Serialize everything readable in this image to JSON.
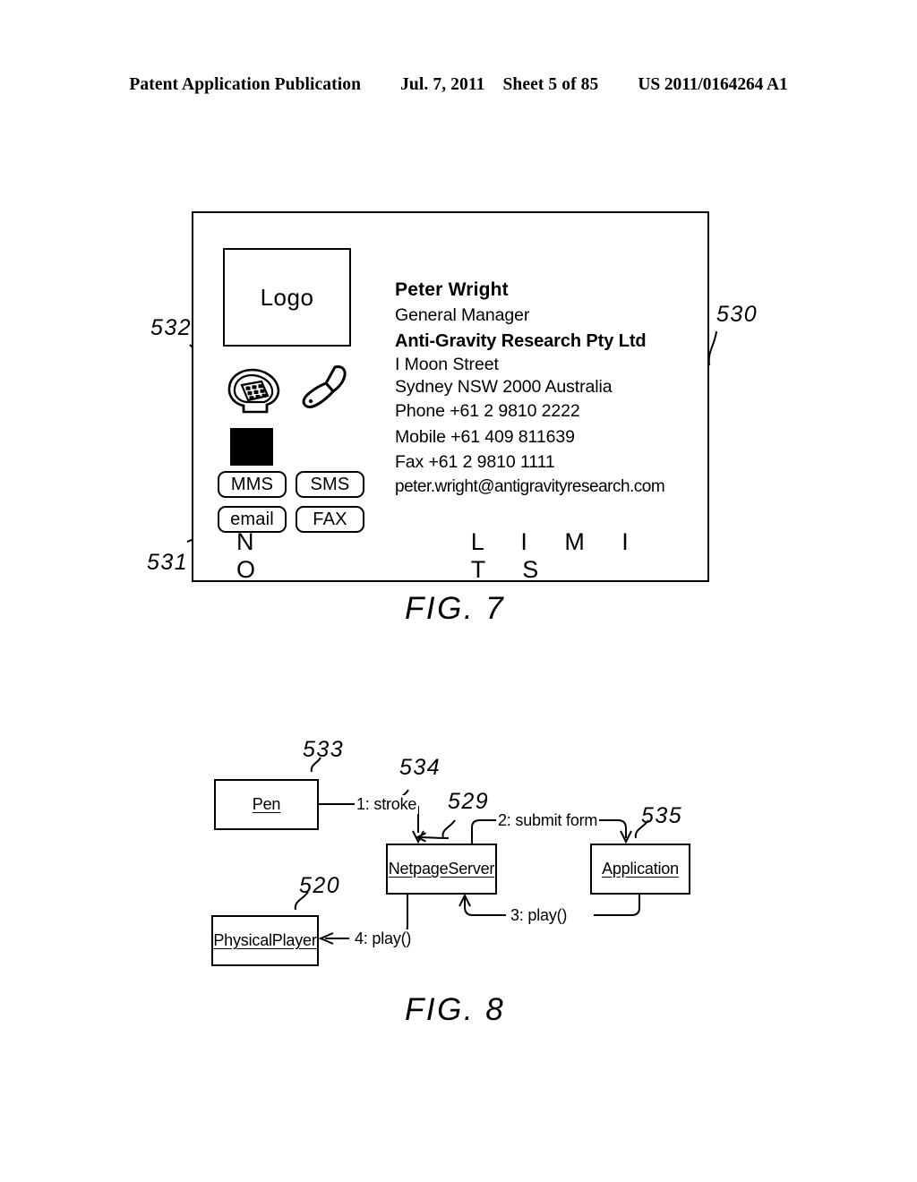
{
  "header": {
    "title": "Patent Application Publication",
    "date": "Jul. 7, 2011",
    "sheet": "Sheet 5 of 85",
    "number": "US 2011/0164264 A1"
  },
  "fig7": {
    "caption": "FIG. 7",
    "logo_label": "Logo",
    "refs": {
      "card": "530",
      "icons": "532",
      "buttons": "531"
    },
    "contact": {
      "name": "Peter Wright",
      "role": "General Manager",
      "company": "Anti-Gravity Research Pty Ltd",
      "street": "I Moon Street",
      "city": "Sydney NSW 2000 Australia",
      "phone": "Phone +61 2 9810 2222",
      "mobile": "Mobile +61 409 811639",
      "fax": "Fax +61 2 9810 1111",
      "email": "peter.wright@antigravityresearch.com"
    },
    "buttons": [
      {
        "label": "MMS"
      },
      {
        "label": "SMS"
      },
      {
        "label": "email"
      },
      {
        "label": "FAX"
      }
    ],
    "tagline": {
      "first": "N O",
      "second": "L I M I T S"
    },
    "icons": {
      "desk_phone": "desk-phone-icon",
      "mobile_phone": "mobile-phone-icon",
      "envelope": "envelope-icon"
    }
  },
  "fig8": {
    "caption": "FIG. 8",
    "nodes": [
      {
        "label": "Pen",
        "ref": "533"
      },
      {
        "label": "NetpageServer",
        "ref": "529"
      },
      {
        "label": "Application",
        "ref": "535"
      },
      {
        "label": "PhysicalPlayer",
        "ref": "520"
      }
    ],
    "messages": [
      {
        "label": "1: stroke",
        "ref": "534"
      },
      {
        "label": "2: submit form"
      },
      {
        "label": "3: play()"
      },
      {
        "label": "4: play()"
      }
    ]
  }
}
